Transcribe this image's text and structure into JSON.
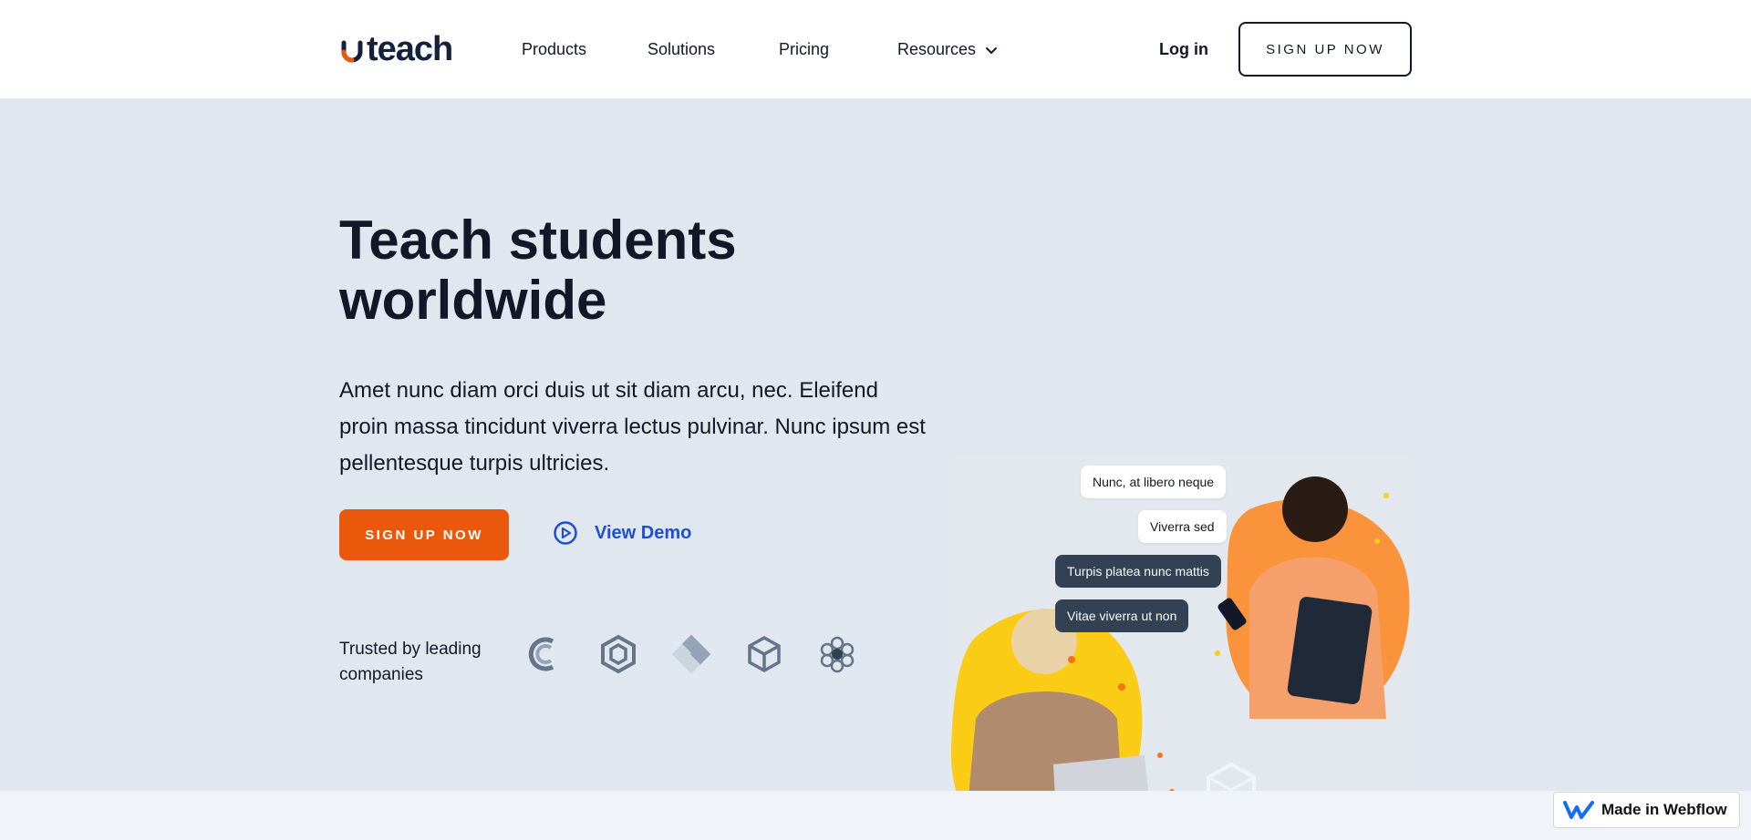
{
  "header": {
    "logo_text": "teach",
    "nav": {
      "products": "Products",
      "solutions": "Solutions",
      "pricing": "Pricing",
      "resources": "Resources"
    },
    "login_label": "Log in",
    "signup_label": "SIGN UP NOW"
  },
  "hero": {
    "title": "Teach students worldwide",
    "description": "Amet nunc diam orci duis ut sit diam arcu, nec. Eleifend proin massa tincidunt viverra lectus pulvinar. Nunc ipsum est pellentesque turpis ultricies.",
    "cta_primary": "SIGN UP NOW",
    "cta_demo": "View Demo",
    "trusted_label": "Trusted by leading companies",
    "company_icons": [
      "c-logo-icon",
      "hexagon-logo-icon",
      "diamond-x-logo-icon",
      "cube-logo-icon",
      "honeycomb-logo-icon"
    ]
  },
  "illustration": {
    "bubbles": [
      "Nunc, at libero neque",
      "Viverra sed",
      "Turpis platea nunc mattis",
      "Vitae viverra ut non"
    ]
  },
  "badge": {
    "label": "Made in Webflow"
  },
  "colors": {
    "accent": "#ea580c",
    "link": "#1d4ed8",
    "hero_bg": "#e1e7ef",
    "dark_text": "#111827"
  }
}
